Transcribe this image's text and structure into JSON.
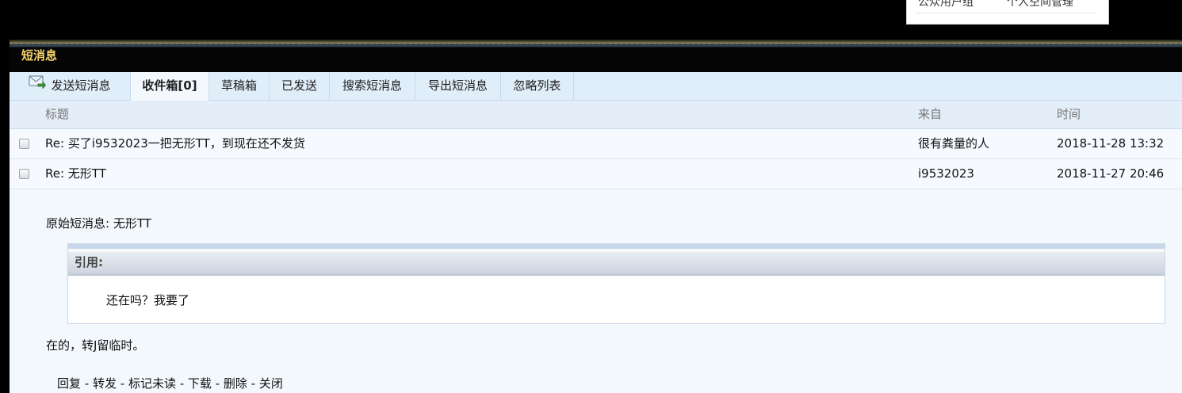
{
  "dropdown": {
    "item1": "公众用户组",
    "item2": "个人空间管理"
  },
  "section_title": "短消息",
  "tabs": [
    {
      "label": "发送短消息",
      "icon": "envelope-send-icon"
    },
    {
      "label": "收件箱[0]",
      "active": true
    },
    {
      "label": "草稿箱"
    },
    {
      "label": "已发送"
    },
    {
      "label": "搜索短消息"
    },
    {
      "label": "导出短消息"
    },
    {
      "label": "忽略列表"
    }
  ],
  "table": {
    "headers": {
      "title": "标题",
      "from": "来自",
      "time": "时间"
    },
    "rows": [
      {
        "title": "Re: 买了i9532023一把无形TT，到现在还不发货",
        "from": "很有粪量的人",
        "time": "2018-11-28 13:32"
      },
      {
        "title": "Re: 无形TT",
        "from": "i9532023",
        "time": "2018-11-27 20:46"
      }
    ]
  },
  "message": {
    "original": "原始短消息: 无形TT",
    "quote_label": "引用:",
    "quote_text": "还在吗？我要了",
    "reply": "在的，转J留临时。"
  },
  "actions": {
    "reply": "回复",
    "forward": "转发",
    "mark_unread": "标记未读",
    "download": "下载",
    "delete": "删除",
    "close": "关闭",
    "separator": " - "
  },
  "colors": {
    "title_gold": "#f5d36b",
    "panel_bg": "#f3f8fd",
    "tab_bg": "#e0eefa"
  }
}
